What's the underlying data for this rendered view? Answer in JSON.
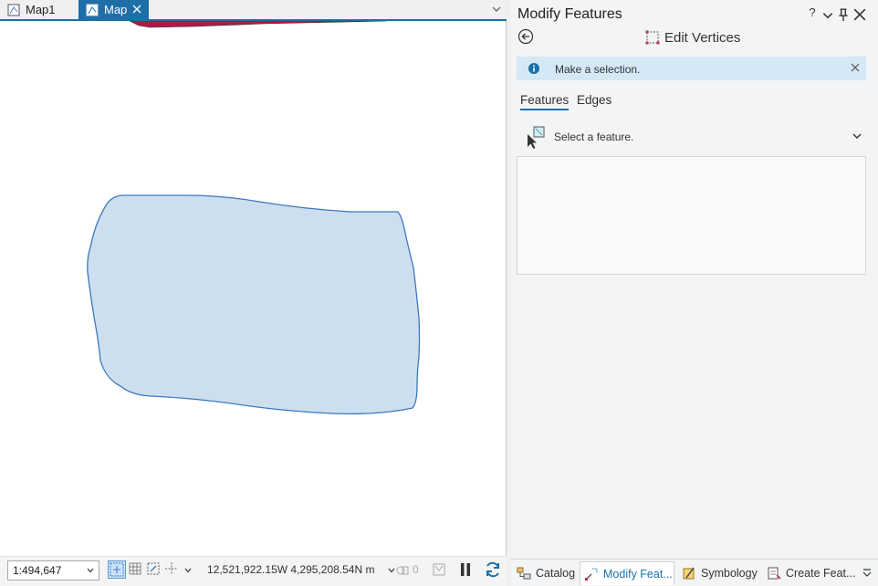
{
  "map_pane": {
    "tabs": [
      {
        "label": "Map1",
        "icon": "map-icon",
        "active": false
      },
      {
        "label": "Map",
        "icon": "map-icon",
        "active": true
      }
    ],
    "status_bar": {
      "scale": "1:494,647",
      "coordinates": "12,521,922.15W 4,295,208.54N m",
      "selected_count": "0"
    },
    "colors": {
      "accent": "#1e6fa8",
      "polygon_fill": "#cddfee",
      "polygon_stroke": "#3c78c0",
      "top_feature_fill": "#b0184a"
    }
  },
  "side_pane": {
    "title": "Modify Features",
    "controls": [
      "?",
      "⌄",
      "⊥",
      "✕"
    ],
    "tool_title": "Edit Vertices",
    "message": "Make a selection.",
    "sub_tabs": [
      {
        "label": "Features",
        "active": true
      },
      {
        "label": "Edges",
        "active": false
      }
    ],
    "select_prompt": "Select a feature.",
    "bottom_tabs": [
      {
        "label": "Catalog",
        "icon": "catalog-icon",
        "active": false
      },
      {
        "label": "Modify Feat...",
        "icon": "modify-features-icon",
        "active": true
      },
      {
        "label": "Symbology",
        "icon": "symbology-icon",
        "active": false
      },
      {
        "label": "Create Feat...",
        "icon": "create-features-icon",
        "active": false
      }
    ]
  }
}
